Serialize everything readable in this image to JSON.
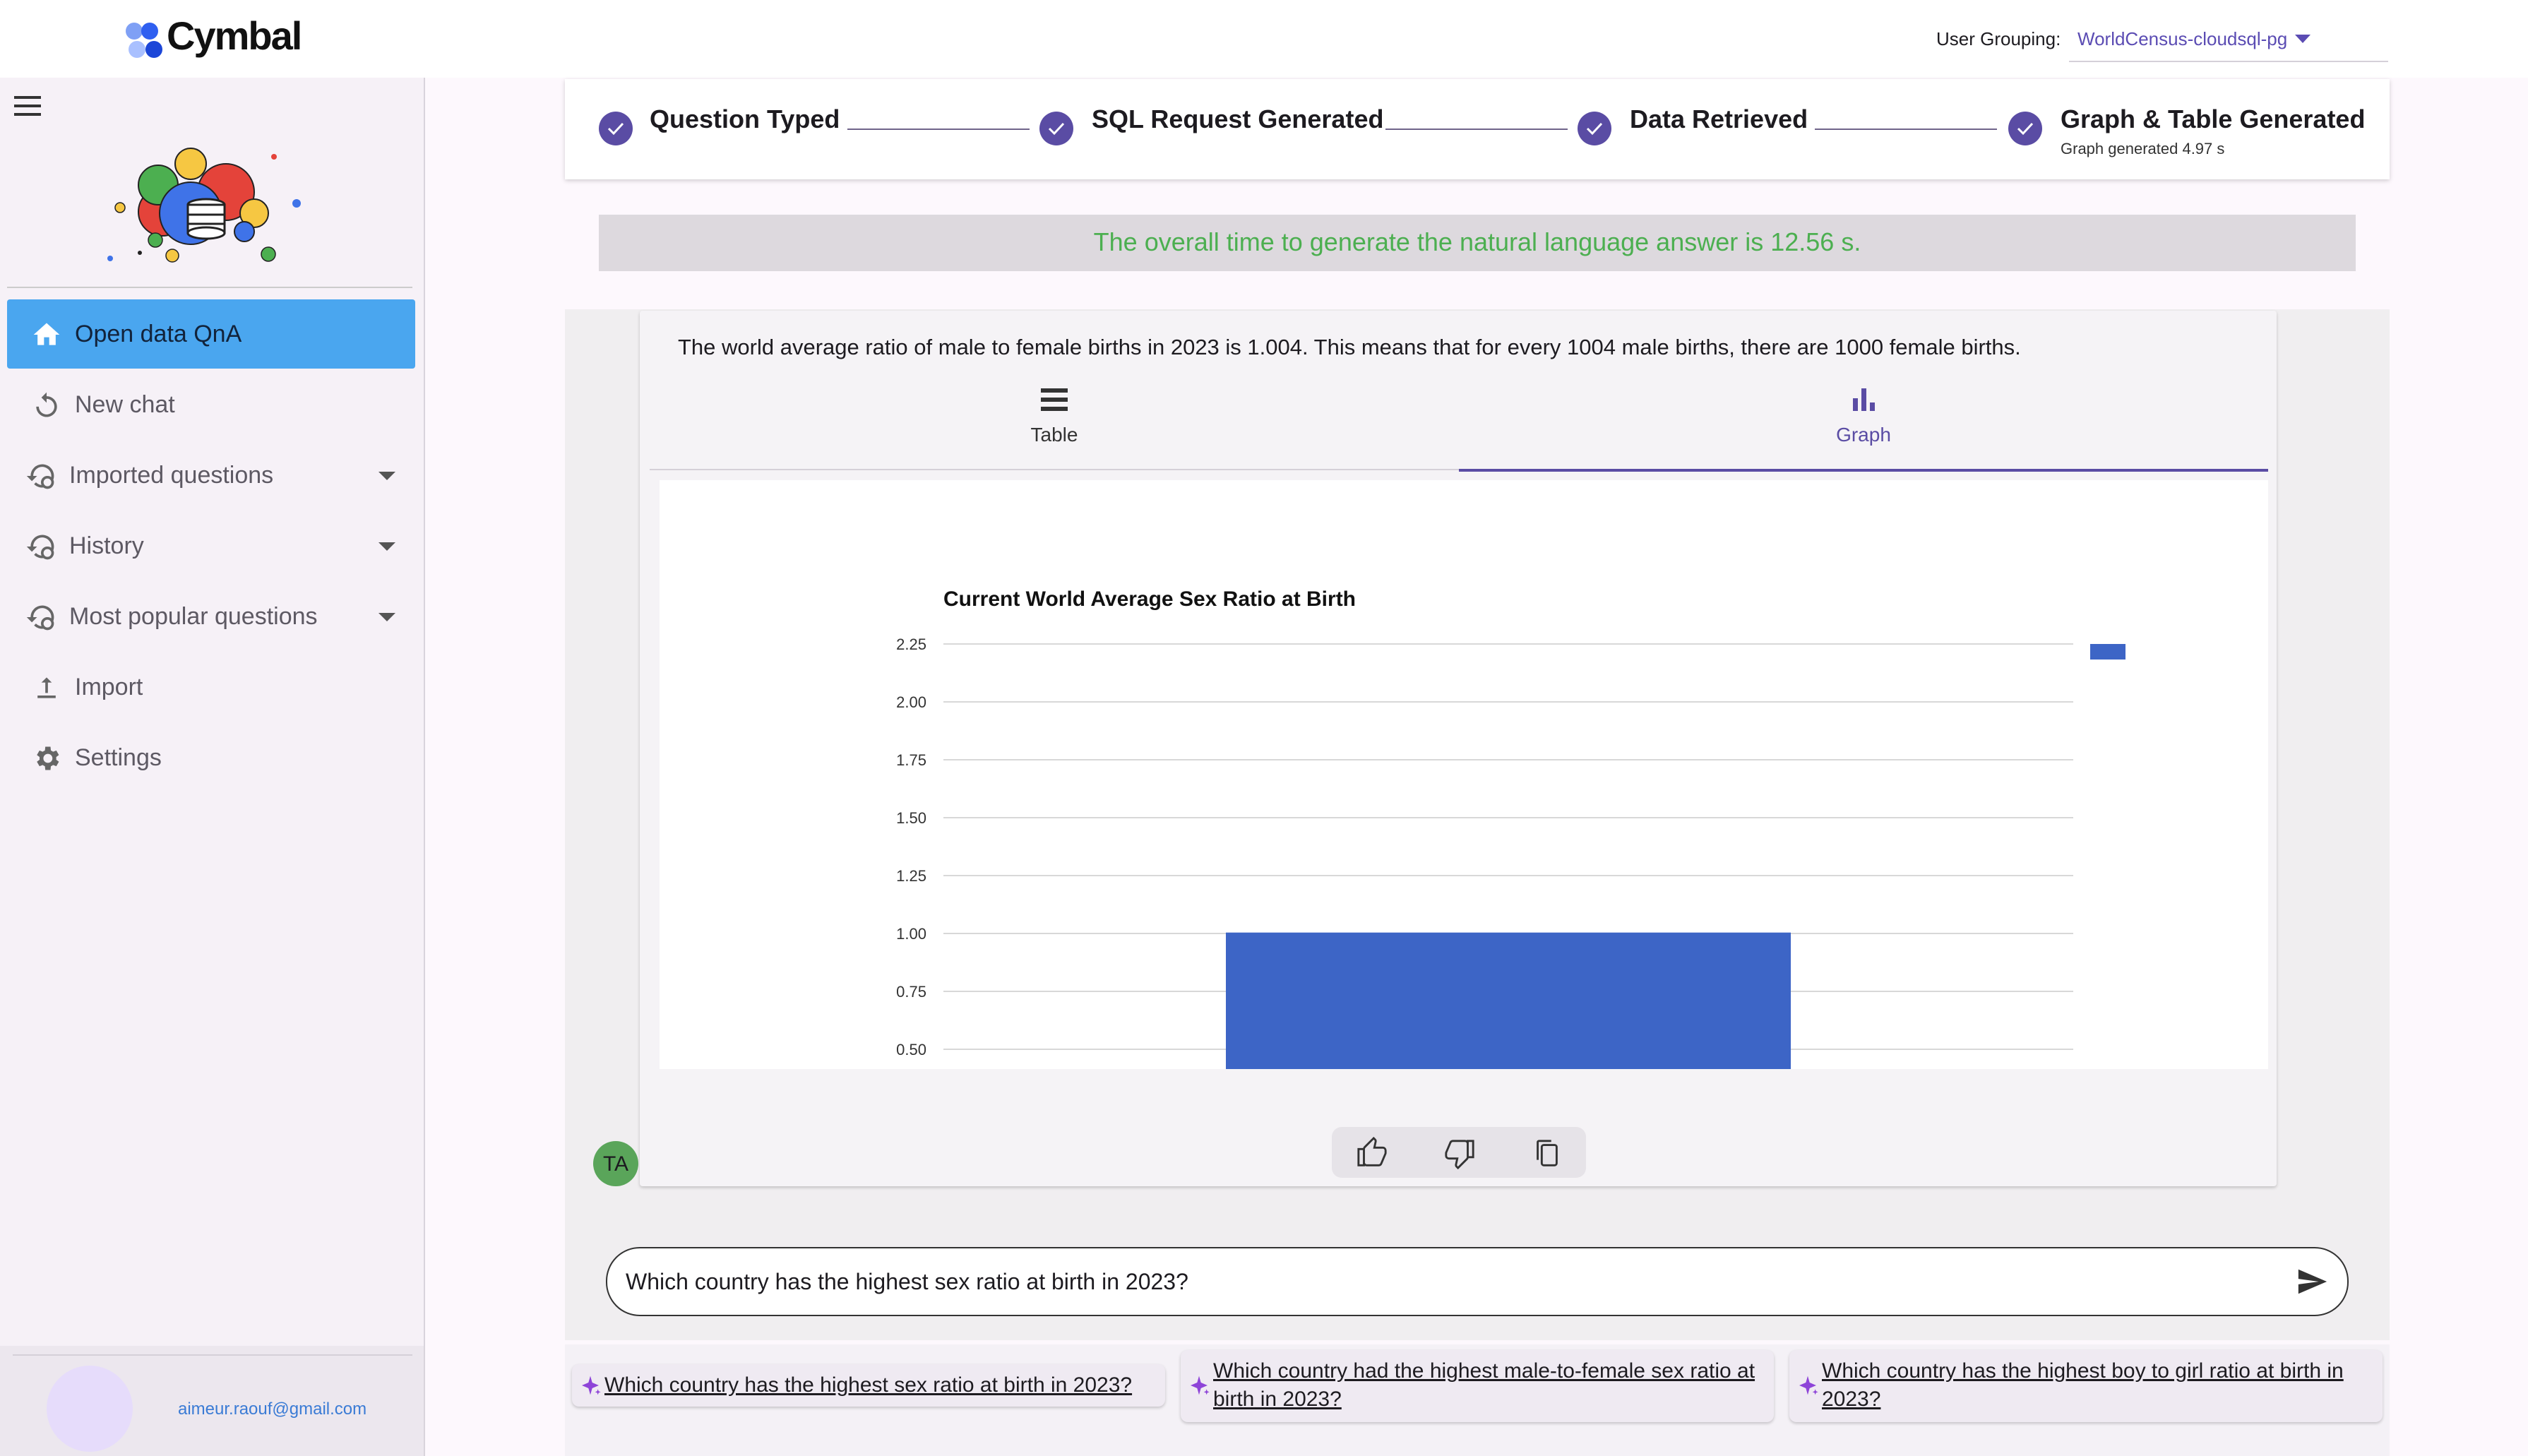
{
  "header": {
    "brand": "Cymbal",
    "user_grouping_label": "User Grouping:",
    "user_grouping_value": "WorldCensus-cloudsql-pg"
  },
  "sidebar": {
    "items": [
      {
        "label": "Open data QnA",
        "icon": "home-icon",
        "active": true
      },
      {
        "label": "New chat",
        "icon": "refresh-icon"
      },
      {
        "label": "Imported questions",
        "icon": "history-settings-icon",
        "expandable": true
      },
      {
        "label": "History",
        "icon": "history-settings-icon",
        "expandable": true
      },
      {
        "label": "Most popular questions",
        "icon": "history-settings-icon",
        "expandable": true
      },
      {
        "label": "Import",
        "icon": "upload-icon"
      },
      {
        "label": "Settings",
        "icon": "gear-icon"
      }
    ],
    "user_email": "aimeur.raouf@gmail.com"
  },
  "stepper": {
    "steps": [
      {
        "label": "Question Typed"
      },
      {
        "label": "SQL Request Generated"
      },
      {
        "label": "Data Retrieved"
      },
      {
        "label": "Graph & Table Generated",
        "sub": "Graph generated 4.97 s"
      }
    ]
  },
  "banner": {
    "text": "The overall time to generate the natural language answer is 12.56 s."
  },
  "answer": {
    "text": "The world average ratio of male to female births in 2023 is 1.004. This means that for every 1004 male births, there are 1000 female births.",
    "tabs": [
      {
        "label": "Table",
        "icon": "table-rows-icon"
      },
      {
        "label": "Graph",
        "icon": "bar-chart-icon",
        "selected": true
      }
    ],
    "avatar_initials": "TA"
  },
  "chart_data": {
    "type": "bar",
    "title": "Current World Average Sex Ratio at Birth",
    "categories": [
      ""
    ],
    "values": [
      1.004
    ],
    "ylim": [
      0.5,
      2.25
    ],
    "yticks": [
      "2.25",
      "2.00",
      "1.75",
      "1.50",
      "1.25",
      "1.00",
      "0.75",
      "0.50"
    ],
    "color": "#3d65c6",
    "grid": true,
    "legend": "top-right"
  },
  "chat_input": {
    "value": "Which country has the highest sex ratio at birth in 2023?"
  },
  "suggestions": [
    "Which country has the highest sex ratio at birth in 2023?",
    "Which country had the highest male-to-female sex ratio at birth in 2023?",
    "Which country has the highest boy to girl ratio at birth in 2023?"
  ],
  "colors": {
    "accent": "#5a4ca4",
    "active_nav": "#4aa6ef",
    "success_text": "#4caf50",
    "bar": "#3d65c6"
  }
}
